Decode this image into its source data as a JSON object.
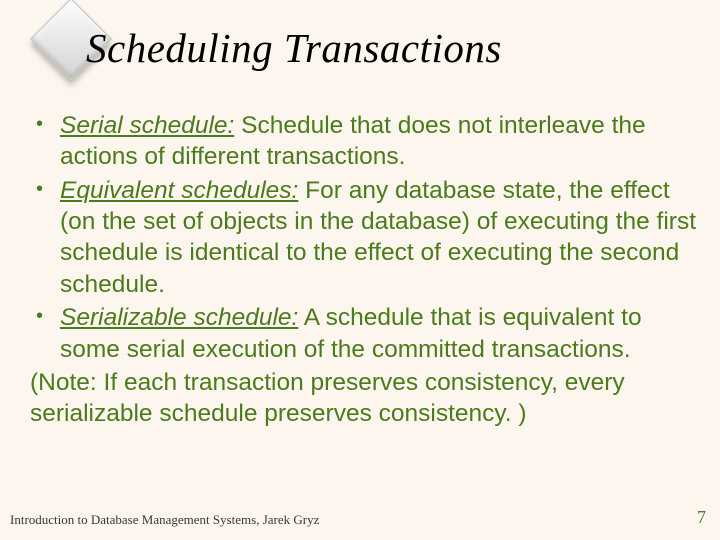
{
  "title": "Scheduling Transactions",
  "bullets": [
    {
      "term": "Serial schedule:",
      "text": " Schedule that does not interleave the actions of different transactions."
    },
    {
      "term": "Equivalent schedules:",
      "text": "  For any database state, the effect (on the set of objects in the database) of executing the first schedule is identical to the effect of executing the second schedule."
    },
    {
      "term": "Serializable schedule:",
      "text": "  A schedule that is equivalent to some serial execution of the committed transactions."
    }
  ],
  "note": "(Note: If each transaction preserves consistency, every serializable schedule preserves consistency. )",
  "footer": "Introduction to  Database Management Systems, Jarek Gryz",
  "page_number": "7"
}
